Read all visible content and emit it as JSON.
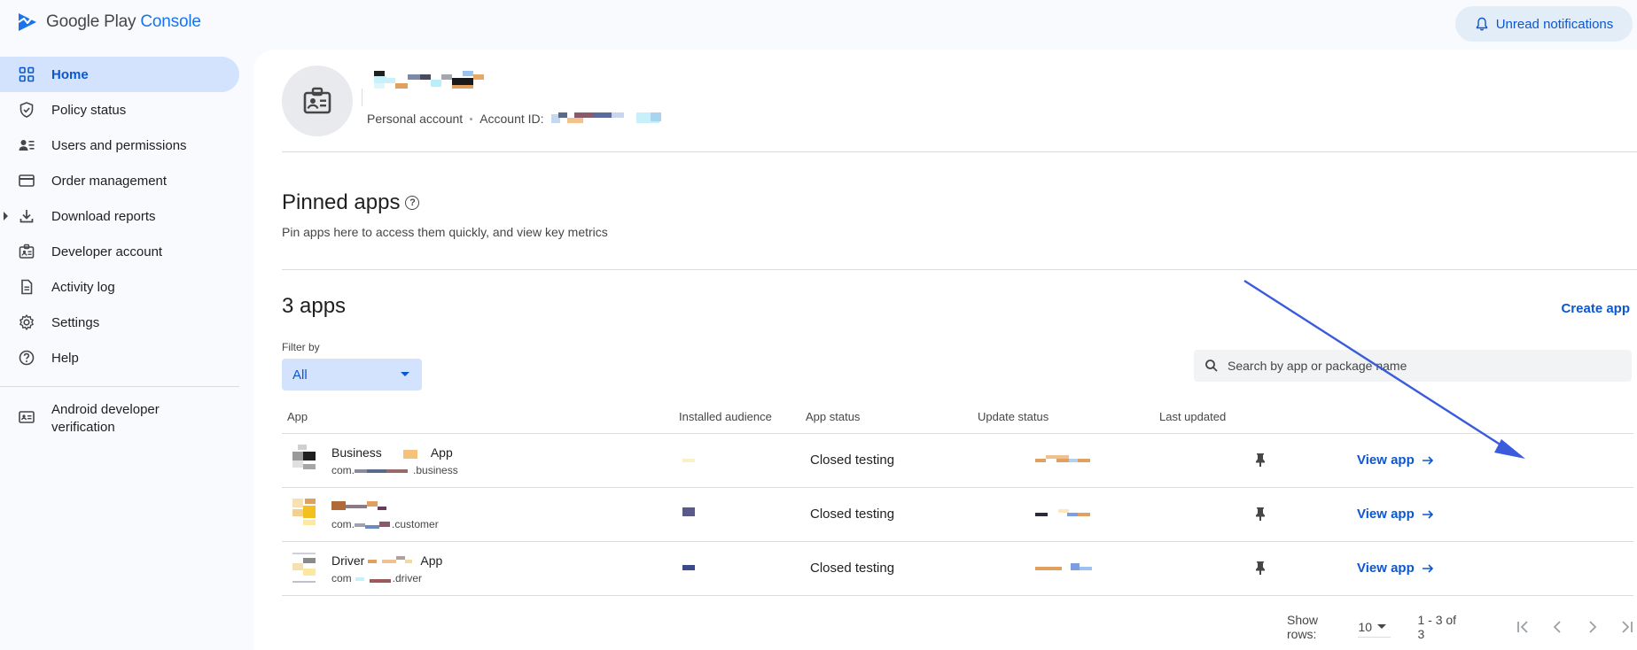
{
  "header": {
    "logo_word1": "Google Play",
    "logo_word2": "Console",
    "notifications_label": "Unread notifications"
  },
  "sidebar": {
    "items": [
      {
        "label": "Home",
        "icon": "grid-icon"
      },
      {
        "label": "Policy status",
        "icon": "shield-icon"
      },
      {
        "label": "Users and permissions",
        "icon": "users-icon"
      },
      {
        "label": "Order management",
        "icon": "card-icon"
      },
      {
        "label": "Download reports",
        "icon": "download-icon"
      },
      {
        "label": "Developer account",
        "icon": "badge-icon"
      },
      {
        "label": "Activity log",
        "icon": "document-icon"
      },
      {
        "label": "Settings",
        "icon": "gear-icon"
      },
      {
        "label": "Help",
        "icon": "help-icon"
      },
      {
        "label": "Android developer verification",
        "icon": "id-card-icon"
      }
    ]
  },
  "account": {
    "type": "Personal account",
    "id_label": "Account ID:"
  },
  "pinned": {
    "title": "Pinned apps",
    "subtitle": "Pin apps here to access them quickly, and view key metrics"
  },
  "apps": {
    "count_label": "3 apps",
    "create_label": "Create app",
    "filter_label": "Filter by",
    "filter_value": "All",
    "search_placeholder": "Search by app or package name",
    "columns": [
      "App",
      "Installed audience",
      "App status",
      "Update status",
      "Last updated"
    ],
    "rows": [
      {
        "name_a": "Business",
        "name_b": "App",
        "pkg_a": "com.",
        "pkg_b": ".business",
        "status": "Closed testing",
        "action": "View app"
      },
      {
        "name_a": "",
        "name_b": "",
        "pkg_a": "com.",
        "pkg_b": ".customer",
        "status": "Closed testing",
        "action": "View app"
      },
      {
        "name_a": "Driver",
        "name_b": "App",
        "pkg_a": "com",
        "pkg_b": ".driver",
        "status": "Closed testing",
        "action": "View app"
      }
    ]
  },
  "pager": {
    "show_rows_label": "Show rows:",
    "rows_value": "10",
    "range": "1 - 3 of 3"
  },
  "colors": {
    "accent": "#0b57d0",
    "active_bg": "#d3e3fd",
    "annotation_arrow": "#3a5bdc"
  }
}
